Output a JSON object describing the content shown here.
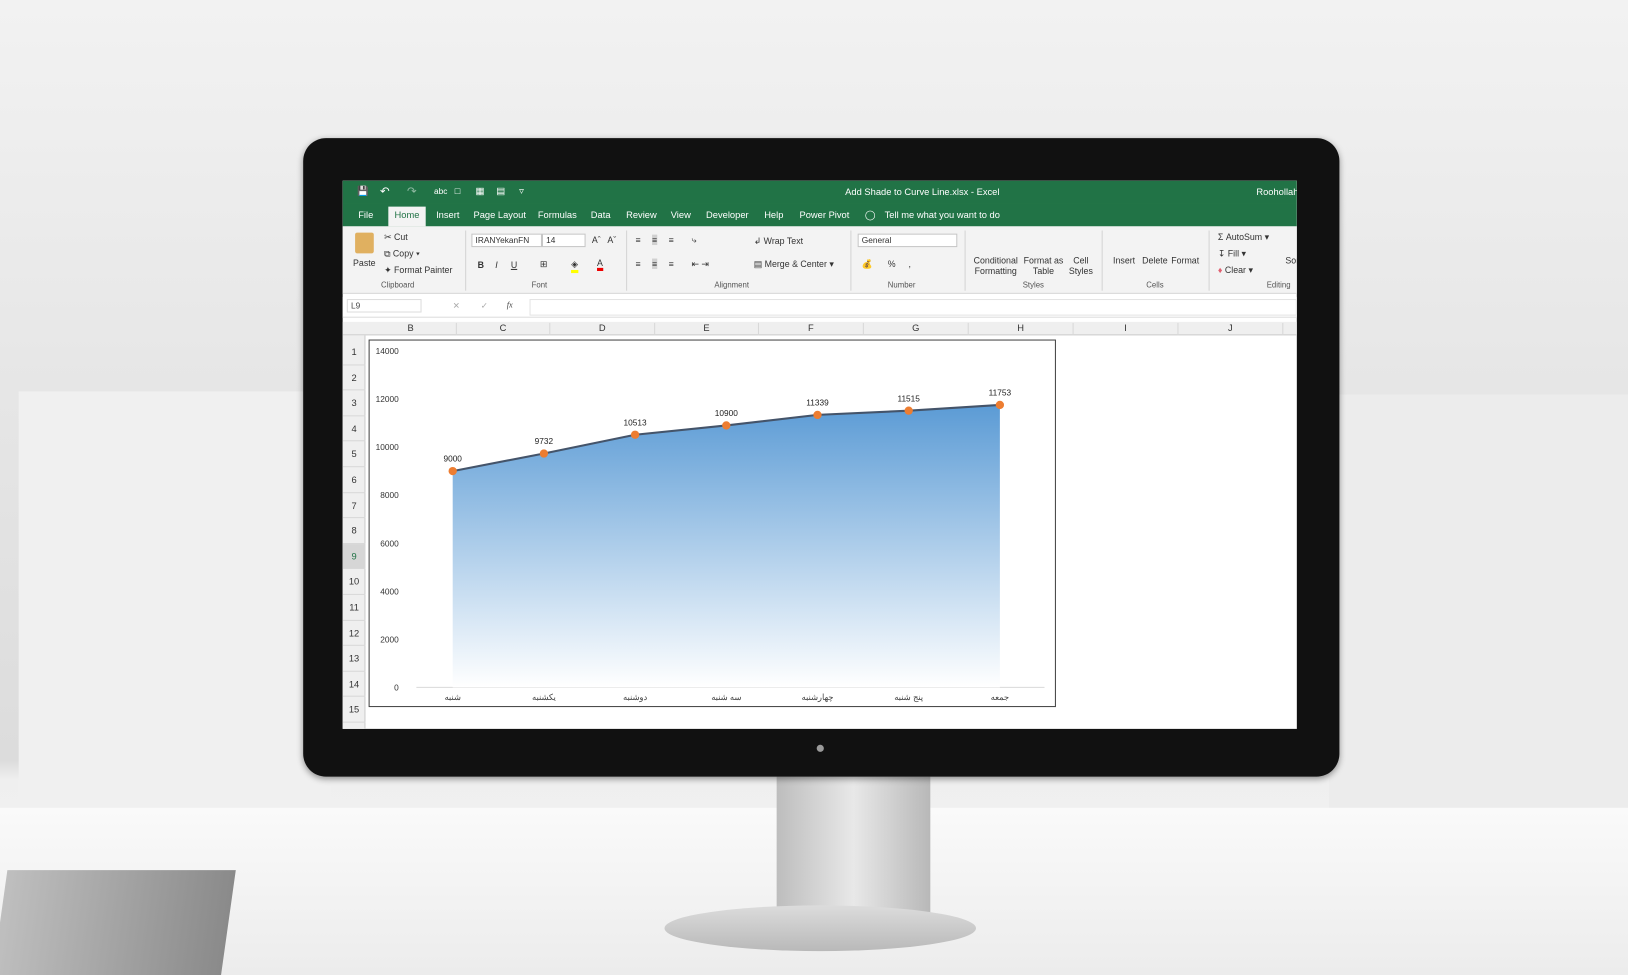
{
  "window": {
    "title": "Add Shade to Curve Line.xlsx  -  Excel",
    "user": "Roohollah"
  },
  "tabs": [
    {
      "label": "File"
    },
    {
      "label": "Home",
      "active": true
    },
    {
      "label": "Insert"
    },
    {
      "label": "Page Layout"
    },
    {
      "label": "Formulas"
    },
    {
      "label": "Data"
    },
    {
      "label": "Review"
    },
    {
      "label": "View"
    },
    {
      "label": "Developer"
    },
    {
      "label": "Help"
    },
    {
      "label": "Power Pivot"
    }
  ],
  "tell_me": "Tell me what you want to do",
  "ribbon": {
    "clipboard": {
      "paste": "Paste",
      "cut": "Cut",
      "copy": "Copy",
      "format_painter": "Format Painter",
      "group": "Clipboard"
    },
    "font": {
      "name": "IRANYekanFN",
      "size": "14",
      "bold": "B",
      "italic": "I",
      "underline": "U",
      "grow": "Aˆ",
      "shrink": "Aˇ",
      "group": "Font"
    },
    "alignment": {
      "wrap": "Wrap Text",
      "merge": "Merge & Center",
      "group": "Alignment"
    },
    "number": {
      "format": "General",
      "percent": "%",
      "comma": ",",
      "group": "Number"
    },
    "styles": {
      "conditional": "Conditional Formatting",
      "format_table": "Format as Table",
      "cell_styles": "Cell Styles",
      "group": "Styles"
    },
    "cells": {
      "insert": "Insert",
      "delete": "Delete",
      "format": "Format",
      "group": "Cells"
    },
    "editing": {
      "autosum": "AutoSum",
      "fill": "Fill",
      "clear": "Clear",
      "sort": "Sort & Filter",
      "group": "Editing"
    }
  },
  "formula_bar": {
    "name_box": "L9",
    "fx": "fx",
    "value": ""
  },
  "columns": [
    "B",
    "C",
    "D",
    "E",
    "F",
    "G",
    "H",
    "I",
    "J"
  ],
  "rows": [
    "1",
    "2",
    "3",
    "4",
    "5",
    "6",
    "7",
    "8",
    "9",
    "10",
    "11",
    "12",
    "13",
    "14",
    "15"
  ],
  "selected_row": "9",
  "colors": {
    "excel_green": "#217346",
    "series_line": "#44546a",
    "marker": "#ed7d31",
    "fill_top": "#5b9bd5"
  },
  "chart_data": {
    "type": "area",
    "categories": [
      "شنبه",
      "یکشنبه",
      "دوشنبه",
      "سه شنبه",
      "چهارشنبه",
      "پنج شنبه",
      "جمعه"
    ],
    "values": [
      9000,
      9732,
      10513,
      10900,
      11339,
      11515,
      11753
    ],
    "data_labels": [
      "9000",
      "9732",
      "10513",
      "10900",
      "11339",
      "11515",
      "11753"
    ],
    "ylim": [
      0,
      14000
    ],
    "yticks": [
      "0",
      "2000",
      "4000",
      "6000",
      "8000",
      "10000",
      "12000",
      "14000"
    ],
    "grid": false,
    "legend": "none",
    "markers": true,
    "fill": "gradient"
  }
}
